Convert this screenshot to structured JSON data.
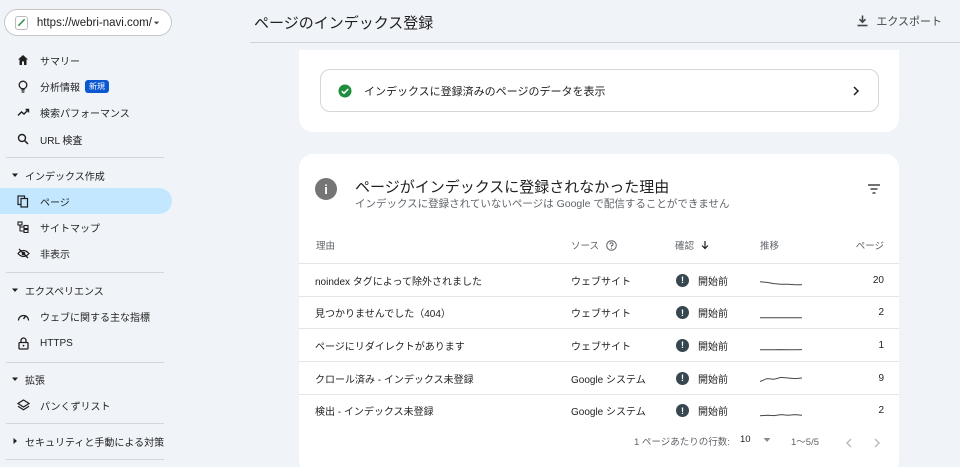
{
  "property": {
    "url": "https://webri-navi.com/"
  },
  "sidebar": {
    "items_top": [
      {
        "label": "サマリー",
        "icon": "home-icon"
      },
      {
        "label": "分析情報",
        "badge": "新規",
        "icon": "lightbulb-icon"
      },
      {
        "label": "検索パフォーマンス",
        "icon": "trending-up-icon"
      },
      {
        "label": "URL 検査",
        "icon": "search-icon"
      }
    ],
    "section_index": "インデックス作成",
    "items_index": [
      {
        "label": "ページ",
        "icon": "pages-icon"
      },
      {
        "label": "サイトマップ",
        "icon": "sitemap-icon"
      },
      {
        "label": "非表示",
        "icon": "eye-off-icon"
      }
    ],
    "section_experience": "エクスペリエンス",
    "items_experience": [
      {
        "label": "ウェブに関する主な指標",
        "icon": "speed-icon"
      },
      {
        "label": "HTTPS",
        "icon": "lock-icon"
      }
    ],
    "section_enhance": "拡張",
    "items_enhance": [
      {
        "label": "パンくずリスト",
        "icon": "layers-icon"
      }
    ],
    "section_security": "セキュリティと手動による対策"
  },
  "header": {
    "title": "ページのインデックス登録",
    "export_label": "エクスポート"
  },
  "indexed_link": {
    "label": "インデックスに登録済みのページのデータを表示"
  },
  "not_indexed": {
    "title": "ページがインデックスに登録されなかった理由",
    "subtitle": "インデックスに登録されていないページは Google で配信することができません",
    "columns": {
      "reason": "理由",
      "source": "ソース",
      "validation": "確認",
      "trend": "推移",
      "pages": "ページ"
    },
    "rows": [
      {
        "reason": "noindex タグによって除外されました",
        "source": "ウェブサイト",
        "validation": "開始前",
        "pages": "20",
        "trend": [
          0.35,
          0.3,
          0.2,
          0.15,
          0.15,
          0.1,
          0.1
        ]
      },
      {
        "reason": "見つかりませんでした（404）",
        "source": "ウェブサイト",
        "validation": "開始前",
        "pages": "2",
        "trend": [
          0.1,
          0.1,
          0.1,
          0.1,
          0.1,
          0.1,
          0.1
        ]
      },
      {
        "reason": "ページにリダイレクトがあります",
        "source": "ウェブサイト",
        "validation": "開始前",
        "pages": "1",
        "trend": [
          0.1,
          0.1,
          0.1,
          0.12,
          0.1,
          0.1,
          0.12
        ]
      },
      {
        "reason": "クロール済み - インデックス未登録",
        "source": "Google システム",
        "validation": "開始前",
        "pages": "9",
        "trend": [
          0.2,
          0.45,
          0.4,
          0.55,
          0.5,
          0.45,
          0.5
        ]
      },
      {
        "reason": "検出 - インデックス未登録",
        "source": "Google システム",
        "validation": "開始前",
        "pages": "2",
        "trend": [
          0.1,
          0.15,
          0.12,
          0.2,
          0.15,
          0.2,
          0.15
        ]
      }
    ],
    "pager": {
      "rows_per_page_label": "1 ページあたりの行数:",
      "rows_per_page": "10",
      "range": "1〜5/5"
    }
  }
}
